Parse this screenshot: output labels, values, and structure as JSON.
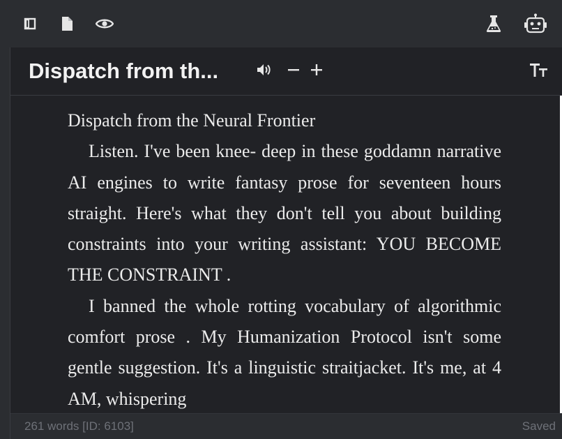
{
  "toolbar": {
    "left_icons": [
      "sidebar-toggle-icon",
      "document-icon",
      "eye-icon"
    ],
    "right_icons": [
      "flask-icon",
      "robot-icon"
    ]
  },
  "header": {
    "title": "Dispatch from th...",
    "controls": [
      "speaker-icon",
      "minus-icon",
      "plus-icon",
      "text-size-icon"
    ]
  },
  "document": {
    "heading": "Dispatch from the Neural Frontier",
    "paragraphs": [
      "Listen. I've been knee- deep in these goddamn narrative AI engines to write fantasy prose for seventeen hours straight. Here's what they don't tell you about building constraints into your writing assistant: YOU BECOME THE CONSTRAINT .",
      "I banned the whole rotting vocabulary of algorithmic comfort prose . My Humanization Protocol isn't some gentle suggestion. It's a linguistic straitjacket. It's me, at 4 AM, whispering"
    ]
  },
  "footer": {
    "word_count": "261 words [ID: 6103]",
    "status": "Saved"
  },
  "colors": {
    "background": "#2b2d31",
    "panel": "#212226",
    "text": "#ececec",
    "muted": "#6e7178"
  }
}
